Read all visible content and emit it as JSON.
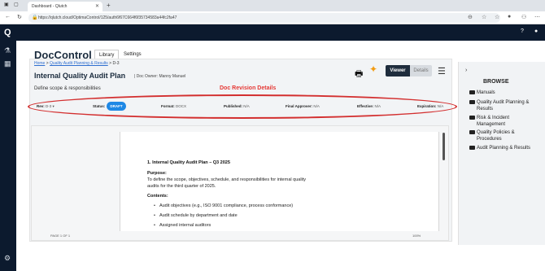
{
  "browser": {
    "tab_title": "Dashboard - Qlutch",
    "url": "https://qlutch.cloud/OptimaControl/125/auth6f67C664f6f35734583a44fc2fa47"
  },
  "app": {
    "name": "DocControl",
    "tabs": [
      {
        "label": "Library"
      },
      {
        "label": "Settings"
      }
    ]
  },
  "breadcrumb": {
    "home": "Home",
    "sep1": ">",
    "section": "Quality Audit Planning & Results",
    "sep2": ">",
    "current": "D-3"
  },
  "document": {
    "title": "Internal Quality Audit Plan",
    "owner": "| Doc Owner: Manny Manuel",
    "description": "Define scope & responsibilities",
    "revision_label": "Doc Revision Details"
  },
  "view_toggle": {
    "viewer": "Viewer",
    "details": "Details"
  },
  "meta": {
    "rev_label": "Rev:",
    "rev_value": "D-3 ▾",
    "status_label": "Status:",
    "status_value": "DRAFT",
    "format_label": "Format:",
    "format_value": "DOCX",
    "published_label": "Published:",
    "published_value": "N/A",
    "approver_label": "Final Approver:",
    "approver_value": "N/A",
    "effective_label": "Effective:",
    "effective_value": "N/A",
    "expiration_label": "Expiration:",
    "expiration_value": "N/A"
  },
  "doc_content": {
    "heading": "1. Internal Quality Audit Plan – Q3 2025",
    "purpose_label": "Purpose:",
    "purpose_text": "To define the scope, objectives, schedule, and responsibilities for internal quality audits for the third quarter of 2025.",
    "contents_label": "Contents:",
    "bullets": [
      "Audit objectives (e.g., ISO 9001 compliance, process conformance)",
      "Audit schedule by department and date",
      "Assigned internal auditors"
    ]
  },
  "viewer_footer": {
    "page": "PAGE 1 OF 1",
    "zoom": "100%"
  },
  "browse": {
    "title": "BROWSE",
    "folders": [
      "Manuals",
      "Quality Audit Planning & Results",
      "Risk & Incident Management",
      "Quality Policies & Procedures",
      "Audit Planning & Results"
    ]
  },
  "colors": {
    "app_bar": "#0c1a2e",
    "accent_red": "#e53935",
    "draft_badge": "#1e88e5",
    "viewer_btn": "#1f2d3d"
  }
}
